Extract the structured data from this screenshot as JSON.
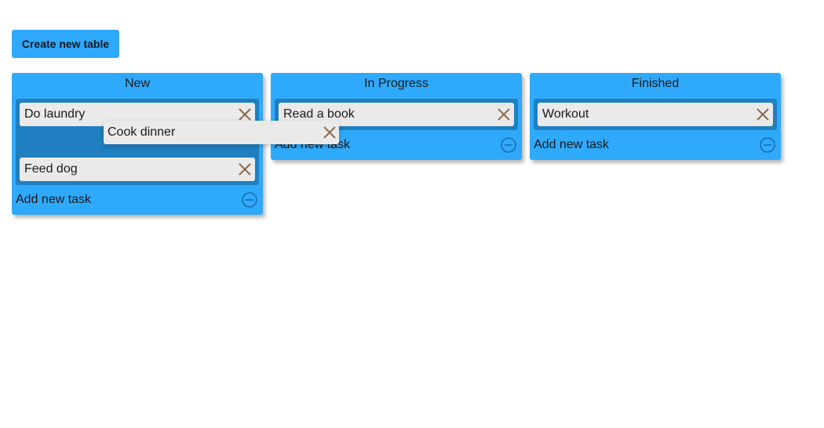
{
  "toolbar": {
    "create_label": "Create new table"
  },
  "boards": [
    {
      "title": "New",
      "tasks": [
        "Do laundry",
        "Feed dog"
      ],
      "footer": "Add new task"
    },
    {
      "title": "In Progress",
      "tasks": [
        "Read a book"
      ],
      "footer": "Add new task"
    },
    {
      "title": "Finished",
      "tasks": [
        "Workout"
      ],
      "footer": "Add new task"
    }
  ],
  "dragging_task": {
    "label": "Cook dinner"
  },
  "icons": {
    "remove_task": "close-x-icon",
    "remove_board": "minus-circle-icon"
  },
  "colors": {
    "accent": "#2fa9fb",
    "task_area": "#1f7fc0",
    "task_bg": "#eaeaea",
    "close_x": "#8a6a4a",
    "minus_icon": "#1a6fb0"
  }
}
